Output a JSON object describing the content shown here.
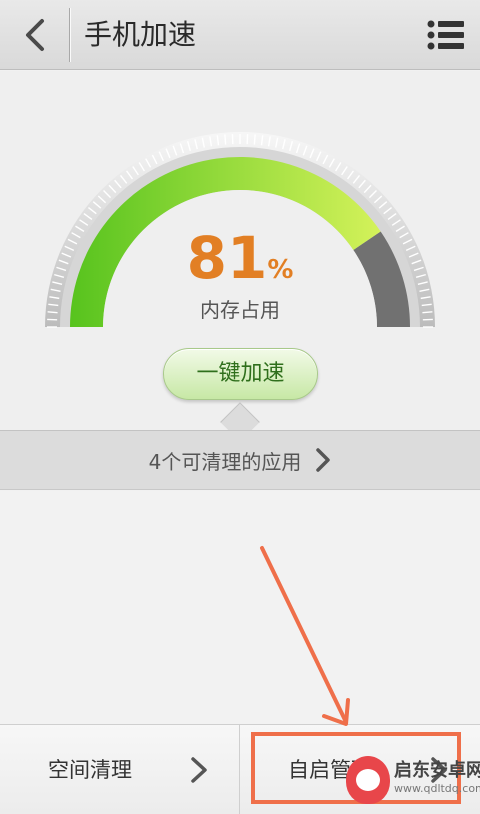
{
  "header": {
    "title": "手机加速"
  },
  "gauge": {
    "percent_value": "81",
    "percent_sign": "%",
    "used_fraction": 0.81,
    "label": "内存占用",
    "colors": {
      "fill_start": "#57c31e",
      "fill_end": "#d4f25a",
      "remaining": "#717171"
    }
  },
  "boost_button": {
    "label": "一键加速"
  },
  "apps_bar": {
    "label": "4个可清理的应用"
  },
  "bottom_bar": {
    "space_clean": "空间清理",
    "autostart": "自启管理"
  },
  "annotation_color": "#ef6f4a",
  "watermark": {
    "name": "启东安卓网",
    "url": "www.qdltdq.com"
  }
}
